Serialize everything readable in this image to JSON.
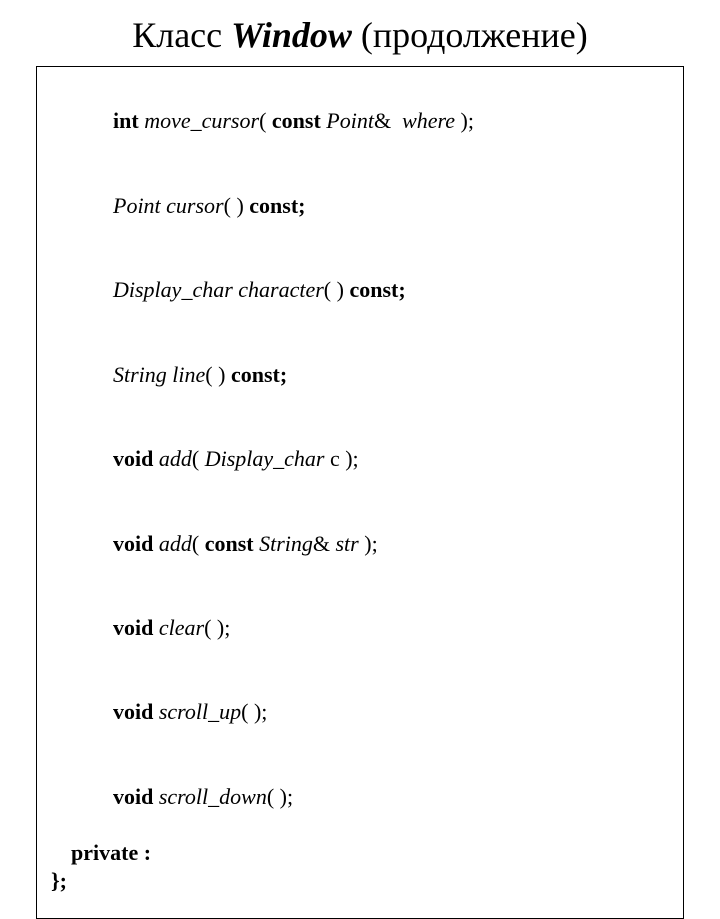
{
  "title": {
    "pre": "Класс ",
    "window": "Window",
    "post": " (продолжение)"
  },
  "code": {
    "l1": {
      "kw1": "int",
      "fn": " move_cursor",
      "p1": "( ",
      "kw2": "const",
      "ty": " Point",
      "p2": "&  ",
      "arg": "where",
      "p3": " );"
    },
    "l2": {
      "ty": "Point cursor",
      "p1": "( ) ",
      "kw": "const;"
    },
    "l3": {
      "ty": "Display_char character",
      "p1": "( ) ",
      "kw": "const;"
    },
    "l4": {
      "ty": "String line",
      "p1": "( ) ",
      "kw": "const;"
    },
    "l5": {
      "kw": "void",
      "fn": " add",
      "p1": "( ",
      "ty": "Display_char",
      "arg": " c );"
    },
    "l6": {
      "kw": "void",
      "fn": " add",
      "p1": "( ",
      "kw2": "const",
      "ty": " String",
      "amp": "& ",
      "arg": "str",
      "p2": " );"
    },
    "l7": {
      "kw": "void",
      "fn": " clear",
      "p": "( );"
    },
    "l8": {
      "kw": "void",
      "fn": " scroll_up",
      "p": "( );"
    },
    "l9": {
      "kw": "void",
      "fn": " scroll_down",
      "p": "( );"
    },
    "l10": "private :",
    "l11": "};"
  }
}
